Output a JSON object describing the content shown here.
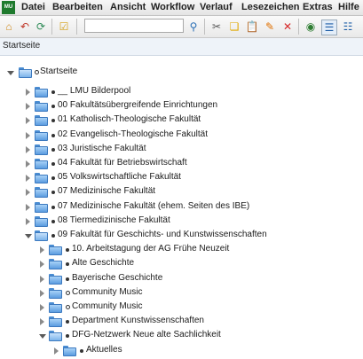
{
  "app": {
    "logo_text": "MU"
  },
  "menubar": {
    "items": [
      "Datei",
      "Bearbeiten",
      "Ansicht",
      "Workflow",
      "Verlauf",
      "Lesezeichen",
      "Extras",
      "Hilfe"
    ]
  },
  "toolbar": {
    "search_value": "",
    "icons": [
      "home-icon",
      "back-icon",
      "refresh-icon",
      "checklist-icon",
      "search-icon",
      "cut-icon",
      "copy-icon",
      "paste-icon",
      "edit-icon",
      "delete-icon",
      "preview-icon",
      "tree-view-icon",
      "list-view-icon"
    ]
  },
  "breadcrumb": {
    "text": "Startseite"
  },
  "tree": {
    "root": {
      "label": "Startseite",
      "marker": "ring"
    },
    "items": [
      {
        "label": "__ LMU Bilderpool",
        "marker": "dot",
        "level": 1,
        "open": false
      },
      {
        "label": "00 Fakultätsübergreifende Einrichtungen",
        "marker": "dot",
        "level": 1,
        "open": false
      },
      {
        "label": "01 Katholisch-Theologische Fakultät",
        "marker": "dot",
        "level": 1,
        "open": false
      },
      {
        "label": "02 Evangelisch-Theologische Fakultät",
        "marker": "dot",
        "level": 1,
        "open": false
      },
      {
        "label": "03 Juristische Fakultät",
        "marker": "dot",
        "level": 1,
        "open": false
      },
      {
        "label": "04 Fakultät für Betriebswirtschaft",
        "marker": "dot",
        "level": 1,
        "open": false
      },
      {
        "label": "05 Volkswirtschaftliche Fakultät",
        "marker": "dot",
        "level": 1,
        "open": false
      },
      {
        "label": "07 Medizinische Fakultät",
        "marker": "dot",
        "level": 1,
        "open": false
      },
      {
        "label": "07 Medizinische Fakultät (ehem. Seiten des IBE)",
        "marker": "dot",
        "level": 1,
        "open": false
      },
      {
        "label": "08 Tiermedizinische Fakultät",
        "marker": "dot",
        "level": 1,
        "open": false
      },
      {
        "label": "09 Fakultät für Geschichts- und Kunstwissenschaften",
        "marker": "dot",
        "level": 1,
        "open": true
      },
      {
        "label": "10. Arbeitstagung der AG Frühe Neuzeit",
        "marker": "dot",
        "level": 2,
        "open": false
      },
      {
        "label": "Alte Geschichte",
        "marker": "dot",
        "level": 2,
        "open": false
      },
      {
        "label": "Bayerische Geschichte",
        "marker": "dot",
        "level": 2,
        "open": false
      },
      {
        "label": "Community Music",
        "marker": "ring",
        "level": 2,
        "open": false
      },
      {
        "label": "Community Music",
        "marker": "ring",
        "level": 2,
        "open": false
      },
      {
        "label": "Department Kunstwissenschaften",
        "marker": "dot",
        "level": 2,
        "open": false
      },
      {
        "label": "DFG-Netzwerk Neue alte Sachlichkeit",
        "marker": "dot",
        "level": 2,
        "open": true
      },
      {
        "label": "Aktuelles",
        "marker": "dot",
        "level": 3,
        "open": false
      }
    ]
  }
}
